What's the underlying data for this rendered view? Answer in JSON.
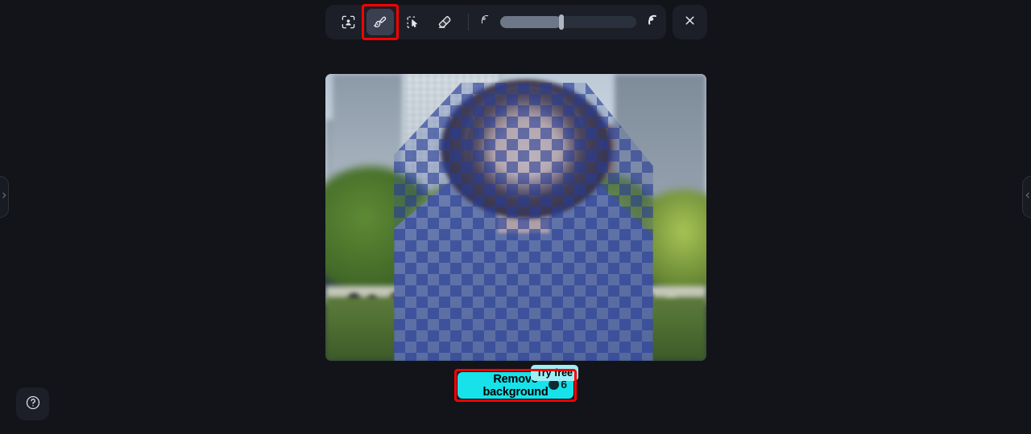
{
  "app": {
    "background_color": "#121419",
    "surface_color": "#1c1f27"
  },
  "toolbar": {
    "tools": [
      {
        "id": "subject-select",
        "label": "Select subject",
        "icon": "person-select-icon",
        "active": false
      },
      {
        "id": "brush",
        "label": "Brush",
        "icon": "brush-icon",
        "active": true
      },
      {
        "id": "magic-select",
        "label": "Magic select",
        "icon": "magic-cursor-icon",
        "active": false
      },
      {
        "id": "eraser",
        "label": "Eraser",
        "icon": "eraser-icon",
        "active": false
      }
    ],
    "brush_size": {
      "label": "Brush size",
      "min_icon": "small-stroke-icon",
      "max_icon": "large-stroke-icon",
      "value_percent": 45
    },
    "close": {
      "label": "Close",
      "icon": "close-icon"
    }
  },
  "canvas": {
    "image_alt": "Person with curly hair standing in a city park, selection mask overlay",
    "mask_label": "selection-checkerboard-overlay"
  },
  "cta": {
    "label_line1": "Remove",
    "label_line2": "background",
    "badge": "Try free",
    "credits": "6",
    "button_color": "#17e2ea",
    "badge_color": "#9df0f5",
    "highlight_color": "#ff0000"
  },
  "panels": {
    "left_handle": {
      "label": "Expand left panel",
      "icon": "chevron-right-icon"
    },
    "right_handle": {
      "label": "Expand right panel",
      "icon": "chevron-left-icon"
    }
  },
  "help": {
    "label": "Help",
    "icon": "help-circle-icon"
  }
}
